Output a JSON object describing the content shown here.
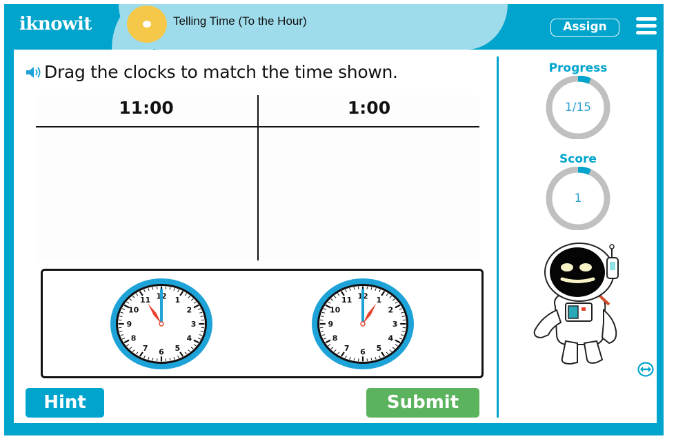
{
  "header": {
    "logo": "iknowit",
    "title": "Telling Time (To the Hour)",
    "assign_label": "Assign",
    "menu_icon": "hamburger-menu-icon",
    "topic_icon": "clock-topic-icon"
  },
  "question": {
    "speaker_icon": "speaker-icon",
    "prompt": "Drag the clocks to match the time shown."
  },
  "columns": [
    {
      "label": "11:00"
    },
    {
      "label": "1:00"
    }
  ],
  "clocks": [
    {
      "hour": 11,
      "minute": 0,
      "label": "clock-showing-11-00"
    },
    {
      "hour": 1,
      "minute": 0,
      "label": "clock-showing-1-00"
    }
  ],
  "clock_numbers": [
    "12",
    "1",
    "2",
    "3",
    "4",
    "5",
    "6",
    "7",
    "8",
    "9",
    "10",
    "11"
  ],
  "buttons": {
    "hint": "Hint",
    "submit": "Submit"
  },
  "progress": {
    "label": "Progress",
    "value": "1/15",
    "current": 1,
    "total": 15
  },
  "score": {
    "label": "Score",
    "value": "1",
    "fraction": 0.0667
  },
  "colors": {
    "brand": "#00a4cc",
    "title_bg": "#9edcec",
    "topic_icon": "#f5c84a",
    "submit": "#5cb35e",
    "ring_track": "#c0c0c0",
    "hour_hand": "#e8432f",
    "minute_hand": "#1ea3d8"
  }
}
